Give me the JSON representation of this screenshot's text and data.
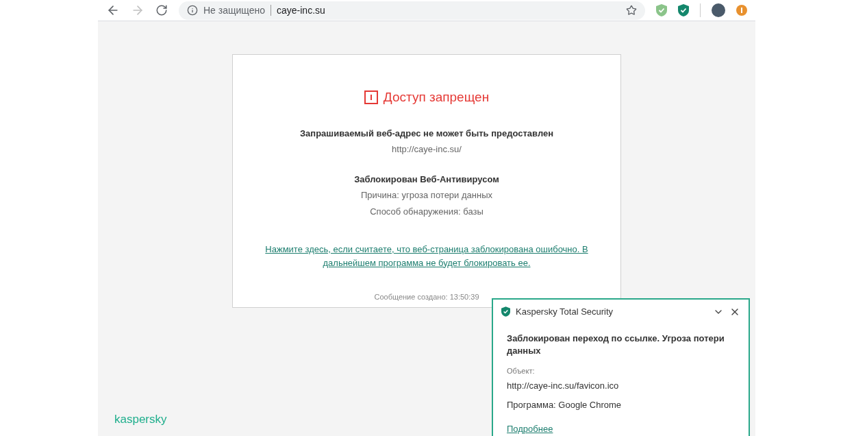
{
  "toolbar": {
    "security_label": "Не защищено",
    "url": "caye-inc.su",
    "bookmarked": false
  },
  "block_page": {
    "title": "Доступ запрещен",
    "heading": "Запрашиваемый веб-адрес не может быть предоставлен",
    "address": "http://caye-inc.su/",
    "blocked_by": "Заблокирован Веб-Антивирусом",
    "reason": "Причина: угроза потери данных",
    "method": "Способ обнаружения: базы",
    "link": "Нажмите здесь, если считаете, что веб-страница заблокирована ошибочно. В дальнейшем программа не будет блокировать ее.",
    "created": "Сообщение создано: 13:50:39"
  },
  "brand": "kaspersky",
  "notification": {
    "app": "Kaspersky Total Security",
    "message": "Заблокирован переход по ссылке. Угроза потери данных",
    "object_label": "Объект:",
    "object": "http://caye-inc.su/favicon.ico",
    "program": "Программа: Google Chrome",
    "more_link": "Подробнее"
  }
}
